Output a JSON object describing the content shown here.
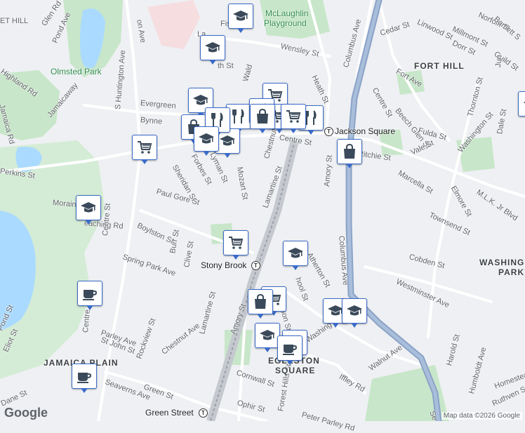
{
  "map": {
    "colors": {
      "land": "#eef0f3",
      "water": "#aadaff",
      "park": "#c8e6c9",
      "road": "#ffffff",
      "highway": "#8ba3c7",
      "rail": "#b0b0b0",
      "pin_border": "#3b6bc9"
    }
  },
  "street_labels": [
    {
      "id": "hill-frag",
      "text": "ET HILL"
    },
    {
      "id": "glen-rd",
      "text": "Glen Rd"
    },
    {
      "id": "pond-ave",
      "text": "Pond Ave"
    },
    {
      "id": "highland-rd",
      "text": "Highland Rd"
    },
    {
      "id": "jamaica-rd",
      "text": "Jamaica Rd"
    },
    {
      "id": "jamaicaway",
      "text": "Jamaicaway"
    },
    {
      "id": "perkins-st",
      "text": "Perkins St"
    },
    {
      "id": "morain-frag",
      "text": "Morain"
    },
    {
      "id": "s-huntington-ave",
      "text": "S Huntington Ave"
    },
    {
      "id": "evergreen",
      "text": "Evergreen"
    },
    {
      "id": "bynner",
      "text": "Bynne"
    },
    {
      "id": "forbes-st",
      "text": "Forbes St"
    },
    {
      "id": "sheridan-st",
      "text": "Sheridan St"
    },
    {
      "id": "lyman-st",
      "text": "Lyman St"
    },
    {
      "id": "mozart-st",
      "text": "Mozart St"
    },
    {
      "id": "chestnut-ave-n",
      "text": "Chestnut Ave"
    },
    {
      "id": "paul-gore-st",
      "text": "Paul Gore St"
    },
    {
      "id": "boylston-st",
      "text": "Boylston St"
    },
    {
      "id": "eaching-rd",
      "text": "eaching Rd"
    },
    {
      "id": "centre-st-w",
      "text": "Centre St"
    },
    {
      "id": "spring-park-ave",
      "text": "Spring Park Ave"
    },
    {
      "id": "burr-st",
      "text": "Burr St"
    },
    {
      "id": "clive-st",
      "text": "Clive St"
    },
    {
      "id": "lamartine-st-n",
      "text": "Lamartine St"
    },
    {
      "id": "lamartine-st-s",
      "text": "Lamartine St"
    },
    {
      "id": "parley-ave",
      "text": "Parley Ave"
    },
    {
      "id": "st-john-st",
      "text": "St John St"
    },
    {
      "id": "rockview-st",
      "text": "Rockview St"
    },
    {
      "id": "chestnut-ave-s",
      "text": "Chestnut Ave"
    },
    {
      "id": "pond-st",
      "text": "Pond St"
    },
    {
      "id": "eliot-st",
      "text": "Eliot St"
    },
    {
      "id": "centre-frag",
      "text": "Centre"
    },
    {
      "id": "seaverns-ave",
      "text": "Seaverns Ave"
    },
    {
      "id": "green-st",
      "text": "Green St"
    },
    {
      "id": "dane-st",
      "text": "Dane St"
    },
    {
      "id": "amory-st-s",
      "text": "Amory St"
    },
    {
      "id": "cornwall-st",
      "text": "Cornwall St"
    },
    {
      "id": "ophir-st",
      "text": "Ophir St"
    },
    {
      "id": "forest-hills-st",
      "text": "Forest Hills St"
    },
    {
      "id": "peter-parley-rd",
      "text": "Peter Parley Rd"
    },
    {
      "id": "iffley-rd",
      "text": "Iffley Rd"
    },
    {
      "id": "walnut-ave",
      "text": "Walnut Ave"
    },
    {
      "id": "washington-st-s",
      "text": "Washing"
    },
    {
      "id": "atherton-st",
      "text": "Atherton St"
    },
    {
      "id": "school-st",
      "text": "hool St"
    },
    {
      "id": "son-st",
      "text": "son St"
    },
    {
      "id": "amory-st-n",
      "text": "Amory St"
    },
    {
      "id": "columbus-ave-s",
      "text": "Columbus Ave"
    },
    {
      "id": "columbus-ave-n",
      "text": "Columbus Ave"
    },
    {
      "id": "heath-st",
      "text": "Heath St"
    },
    {
      "id": "centre-st-jackson",
      "text": "Centre St"
    },
    {
      "id": "wensley-st",
      "text": "Wensley St"
    },
    {
      "id": "fisher-frag",
      "text": "Fish"
    },
    {
      "id": "walden-frag",
      "text": "Wald"
    },
    {
      "id": "th-st-frag",
      "text": "th St"
    },
    {
      "id": "la-frag",
      "text": "La"
    },
    {
      "id": "on-ave-frag",
      "text": "on Ave"
    },
    {
      "id": "cedar-st",
      "text": "Cedar St"
    },
    {
      "id": "linwood-st",
      "text": "Linwood St"
    },
    {
      "id": "millmont-st",
      "text": "Millmont St"
    },
    {
      "id": "dorr-st",
      "text": "Dorr St"
    },
    {
      "id": "norfolk-st",
      "text": "Norfolk St"
    },
    {
      "id": "bartlett-st",
      "text": "Bartlett S"
    },
    {
      "id": "guild-st",
      "text": "Guild St"
    },
    {
      "id": "fort-ave",
      "text": "Fort Ave"
    },
    {
      "id": "centre-st-fort",
      "text": "Centre St"
    },
    {
      "id": "beech-glen-st",
      "text": "Beech Glen St"
    },
    {
      "id": "juniper-frag",
      "text": "Jun"
    },
    {
      "id": "thornton-st",
      "text": "Thornton St"
    },
    {
      "id": "fulda-st",
      "text": "Fulda St"
    },
    {
      "id": "ritchie-st",
      "text": "Ritchie St"
    },
    {
      "id": "vale-st",
      "text": "Vale St"
    },
    {
      "id": "marcella-st",
      "text": "Marcella St"
    },
    {
      "id": "washington-st-n",
      "text": "Washington St"
    },
    {
      "id": "dale-st",
      "text": "Dale St"
    },
    {
      "id": "mlk-blvd",
      "text": "M.L.K. Jr Blvd"
    },
    {
      "id": "elmore-st",
      "text": "Elmore St"
    },
    {
      "id": "townsend-st",
      "text": "Townsend St"
    },
    {
      "id": "cobden-st",
      "text": "Cobden St"
    },
    {
      "id": "westminster-ave",
      "text": "Westminster Ave"
    },
    {
      "id": "harold-st",
      "text": "Harold St"
    },
    {
      "id": "humboldt-ave",
      "text": "Humboldt Ave"
    },
    {
      "id": "homestead-st",
      "text": "Homestead S"
    },
    {
      "id": "ruthven-st",
      "text": "Ruthven St"
    },
    {
      "id": "se-frag",
      "text": "Se"
    }
  ],
  "place_labels": {
    "olmsted_park": "Olmsted Park",
    "mclaughlin_1": "McLaughlin",
    "mclaughlin_2": "Playground",
    "fort_hill": "FORT HILL",
    "washington_park_1": "WASHING",
    "washington_park_2": "PARK",
    "jamaica_plain": "JAMAICA PLAIN",
    "egleston_1": "EGLESTON",
    "egleston_2": "SQUARE"
  },
  "stations": {
    "jackson_square": "Jackson Square",
    "stony_brook": "Stony Brook",
    "green_street": "Green Street"
  },
  "transit_symbol": "T",
  "pins": [
    {
      "icon": "school",
      "id": "school-fisher"
    },
    {
      "icon": "school",
      "id": "school-north"
    },
    {
      "icon": "school",
      "id": "school-evergreen"
    },
    {
      "icon": "shopping-bag",
      "id": "bag-centre-1"
    },
    {
      "icon": "grocery",
      "id": "cart-centre-1"
    },
    {
      "icon": "restaurant",
      "id": "rest-centre-1"
    },
    {
      "icon": "school",
      "id": "school-lyman"
    },
    {
      "icon": "restaurant",
      "id": "rest-centre-2"
    },
    {
      "icon": "restaurant",
      "id": "rest-centre-3"
    },
    {
      "icon": "grocery",
      "id": "cart-centre-2"
    },
    {
      "icon": "grocery",
      "id": "cart-centre-3"
    },
    {
      "icon": "restaurant",
      "id": "rest-centre-4"
    },
    {
      "icon": "shopping-bag",
      "id": "bag-centre-2"
    },
    {
      "icon": "school",
      "id": "school-centre"
    },
    {
      "icon": "grocery",
      "id": "cart-west"
    },
    {
      "icon": "shopping-bag",
      "id": "bag-jackson"
    },
    {
      "icon": "school",
      "id": "school-moraine"
    },
    {
      "icon": "grocery",
      "id": "cart-stony-brook"
    },
    {
      "icon": "school",
      "id": "school-atherton"
    },
    {
      "icon": "coffee",
      "id": "coffee-centre"
    },
    {
      "icon": "grocery",
      "id": "cart-school-st"
    },
    {
      "icon": "shopping-bag",
      "id": "bag-school-st"
    },
    {
      "icon": "school",
      "id": "school-washington-1"
    },
    {
      "icon": "school",
      "id": "school-washington-2"
    },
    {
      "icon": "school",
      "id": "school-egleston-1"
    },
    {
      "icon": "school",
      "id": "school-egleston-2"
    },
    {
      "icon": "coffee",
      "id": "coffee-egleston"
    },
    {
      "icon": "coffee",
      "id": "coffee-jamaica-plain"
    },
    {
      "icon": "map-layers",
      "id": "map-layers-partial"
    }
  ],
  "logo": "Google",
  "attribution": "Map data ©2026 Google"
}
